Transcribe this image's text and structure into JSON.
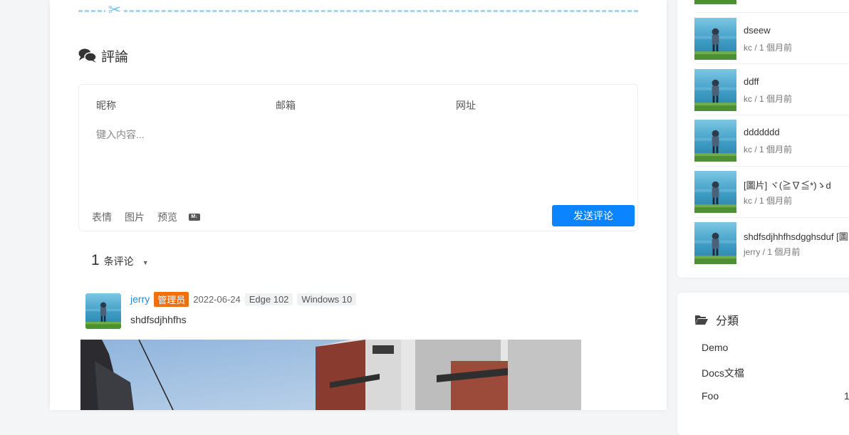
{
  "comments": {
    "title": "評論",
    "form": {
      "nickname_placeholder": "昵称",
      "email_placeholder": "邮箱",
      "url_placeholder": "网址",
      "content_placeholder": "键入内容...",
      "tools": [
        "表情",
        "图片",
        "预览"
      ],
      "markdown_badge": "M↓",
      "submit_label": "发送评论"
    },
    "count": "1",
    "count_label": "条评论",
    "list": [
      {
        "author": "jerry",
        "badge": "管理员",
        "date": "2022-06-24",
        "browser": "Edge 102",
        "os": "Windows 10",
        "text": "shdfsdjhhfhs"
      }
    ]
  },
  "sidebar": {
    "recent": [
      {
        "title": "dseew",
        "meta": "kc / 1 個月前"
      },
      {
        "title": "ddff",
        "meta": "kc / 1 個月前"
      },
      {
        "title": "ddddddd",
        "meta": "kc / 1 個月前"
      },
      {
        "title": "[圖片] ヾ(≧∇≦*)ゝd",
        "meta": "kc / 1 個月前"
      },
      {
        "title": "shdfsdjhhfhsdgghsduf [圖",
        "meta": "jerry / 1 個月前"
      }
    ],
    "categories_title": "分類",
    "categories": [
      {
        "name": "Demo",
        "count": ""
      },
      {
        "name": "Docs文檔",
        "count": ""
      },
      {
        "name": "Foo",
        "count": "1"
      }
    ]
  },
  "colors": {
    "accent": "#0a84ff",
    "badge": "#f07010",
    "divider": "#9fd7ee",
    "author_link": "#1e88e5"
  }
}
